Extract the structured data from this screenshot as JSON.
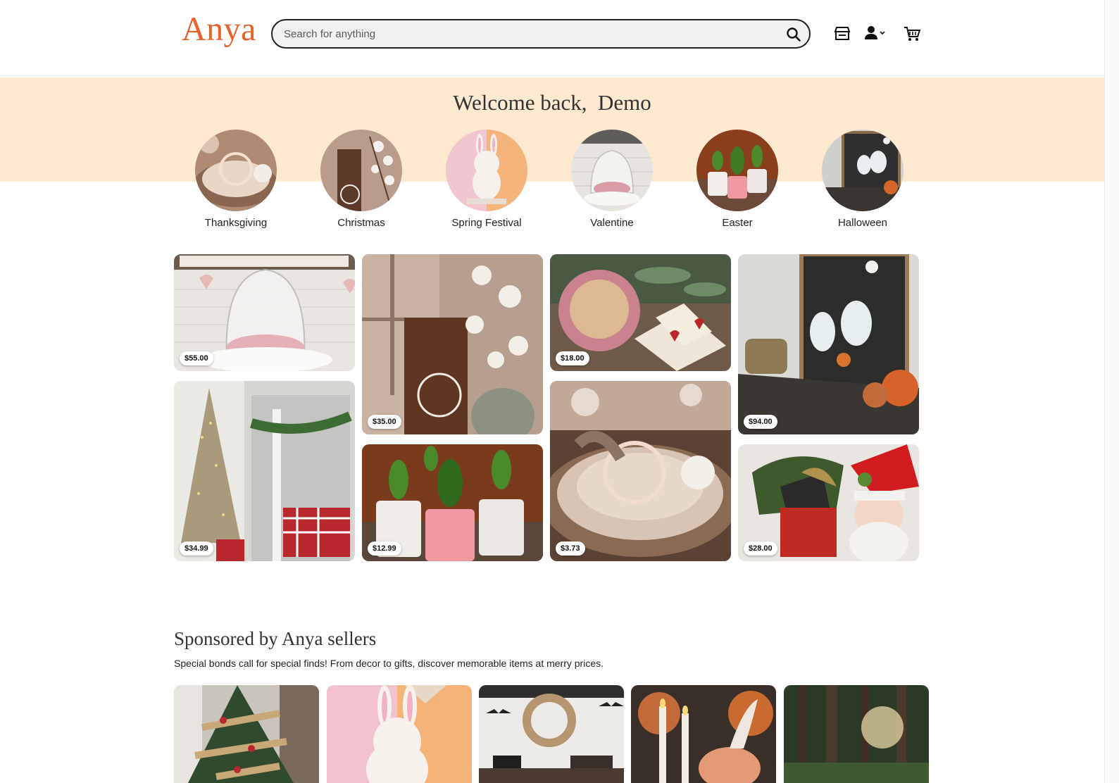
{
  "header": {
    "logo": "Anya",
    "search_placeholder": "Search for anything",
    "icons": [
      "search-icon",
      "shop-icon",
      "user-icon",
      "chevron-down-icon",
      "cart-icon"
    ]
  },
  "welcome": {
    "greeting": "Welcome back,",
    "name": "Demo"
  },
  "categories": [
    {
      "label": "Thanksgiving"
    },
    {
      "label": "Christmas"
    },
    {
      "label": "Spring Festival"
    },
    {
      "label": "Valentine"
    },
    {
      "label": "Easter"
    },
    {
      "label": "Halloween"
    }
  ],
  "products": [
    {
      "price": "$55.00"
    },
    {
      "price": "$35.00"
    },
    {
      "price": "$18.00"
    },
    {
      "price": "$94.00"
    },
    {
      "price": "$34.99"
    },
    {
      "price": "$12.99"
    },
    {
      "price": "$3.73"
    },
    {
      "price": "$28.00"
    }
  ],
  "sponsored": {
    "title": "Sponsored by Anya sellers",
    "subtitle": "Special bonds call for special finds! From decor to gifts, discover memorable items at merry prices."
  },
  "colors": {
    "brand": "#e8612c",
    "band": "#fde8d0"
  }
}
